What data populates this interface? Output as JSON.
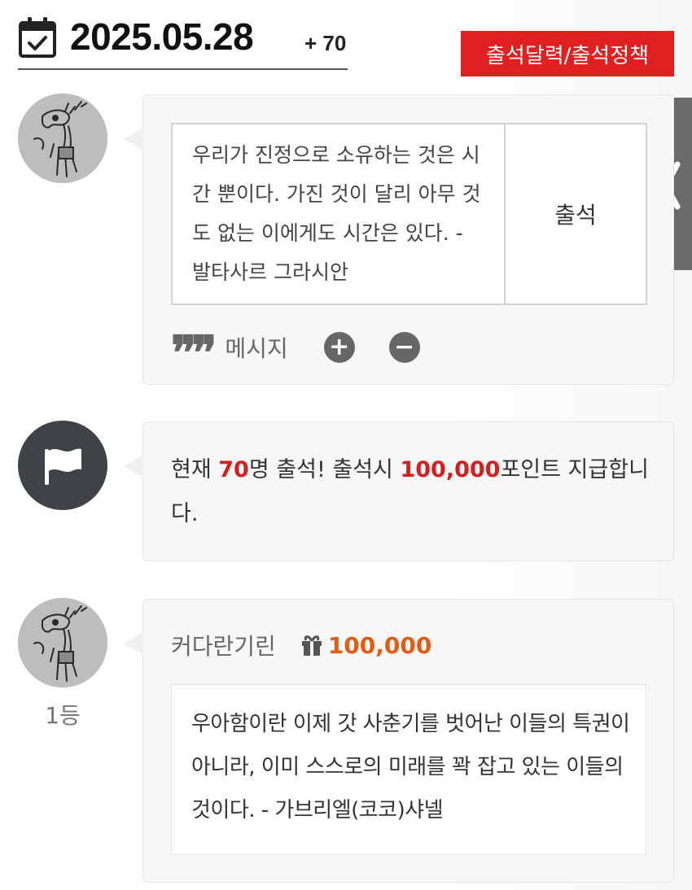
{
  "header": {
    "date": "2025.05.28",
    "count_badge": "+ 70",
    "policy_button": "출석달력/출석정책"
  },
  "entry": {
    "message": "우리가 진정으로 소유하는 것은 시간 뿐이다. 가진 것이 달리 아무 것도 없는 이에게도 시간은 있다. - 발타사르 그라시안",
    "attend_button": "출석",
    "message_label": "메시지",
    "plus_label": "+",
    "minus_label": "−"
  },
  "notice": {
    "prefix": "현재 ",
    "count": "70",
    "middle": "명 출석! 출석시 ",
    "points": "100,000",
    "suffix": "포인트 지급합니다."
  },
  "first_place": {
    "rank": "1등",
    "username": "커다란기린",
    "points": "100,000",
    "quote": "우아함이란 이제 갓 사춘기를 벗어난 이들의 특권이 아니라, 이미 스스로의 미래를 꽉 잡고 있는 이들의 것이다. - 가브리엘(코코)샤넬"
  },
  "icons": {
    "calendar": "calendar-check-icon",
    "side_tab": "chevron-left-icon",
    "quote": "quote-icon",
    "flag": "flag-icon",
    "gift": "gift-icon"
  },
  "colors": {
    "accent_red": "#e02020",
    "highlight_red": "#d81d1d",
    "points_orange": "#e65b12",
    "side_tab_gray": "#6a6a6a",
    "flag_avatar_bg": "#3f4347"
  }
}
